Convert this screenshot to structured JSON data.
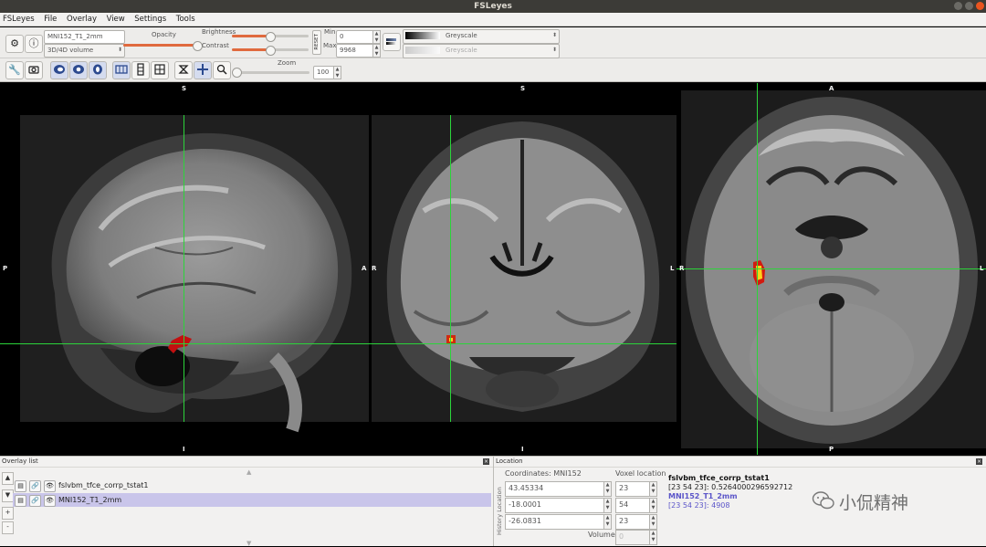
{
  "window": {
    "title": "FSLeyes"
  },
  "menu": {
    "items": [
      "FSLeyes",
      "File",
      "Overlay",
      "View",
      "Settings",
      "Tools"
    ]
  },
  "toolbar": {
    "overlay_name": "MNI152_T1_2mm",
    "overlay_type": "3D/4D volume",
    "opacity_label": "Opacity",
    "brightness_label": "Brightness",
    "contrast_label": "Contrast",
    "reset_label": "RESET",
    "min_label": "Min.",
    "max_label": "Max.",
    "min_value": "0",
    "max_value": "9968",
    "colormap": "Greyscale",
    "neg_colormap": "Greyscale",
    "zoom_label": "Zoom",
    "zoom_value": "100"
  },
  "views": {
    "sagittal": {
      "top": "S",
      "bottom": "I",
      "left": "P",
      "right": "A"
    },
    "coronal": {
      "top": "S",
      "bottom": "I",
      "left": "R",
      "right": "L"
    },
    "axial": {
      "top": "A",
      "bottom": "P",
      "left": "R",
      "right": "L"
    }
  },
  "overlay_list": {
    "title": "Overlay list",
    "items": [
      {
        "name": "fslvbm_tfce_corrp_tstat1",
        "selected": false
      },
      {
        "name": "MNI152_T1_2mm",
        "selected": true
      }
    ]
  },
  "location": {
    "title": "Location",
    "side_tabs": "History  Location",
    "coords_label": "Coordinates: MNI152",
    "voxel_label": "Voxel location",
    "coords": [
      "43.45334",
      "-18.0001",
      "-26.0831"
    ],
    "voxels": [
      "23",
      "54",
      "23"
    ],
    "volume_label": "Volume",
    "volume_value": "0",
    "info": [
      {
        "text": "fslvbm_tfce_corrp_tstat1",
        "color": "#111111",
        "bold": true
      },
      {
        "text": "[23 54 23]: 0.5264000296592712",
        "color": "#222222",
        "bold": false
      },
      {
        "text": "MNI152_T1_2mm",
        "color": "#5b55c9",
        "bold": true
      },
      {
        "text": "[23 54 23]: 4908",
        "color": "#5b55c9",
        "bold": false
      }
    ]
  },
  "watermark": {
    "text": "小侃精神"
  },
  "colors": {
    "crosshair": "#2bd43a",
    "slider": "#e06a3e",
    "selection": "#c9c5ea"
  }
}
